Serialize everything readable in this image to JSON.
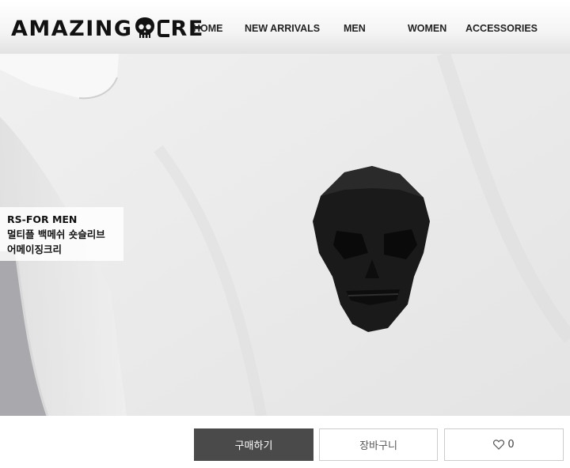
{
  "brand": {
    "logo_left": "AMAZING",
    "logo_right": "RE"
  },
  "nav": {
    "items": [
      {
        "label": "HOME"
      },
      {
        "label": "NEW ARRIVALS"
      },
      {
        "label": "MEN"
      },
      {
        "label": "WOMEN"
      },
      {
        "label": "ACCESSORIES"
      }
    ]
  },
  "product": {
    "caption_line1": "RS-FOR MEN",
    "caption_line2": "멀티플 백메쉬 숏슬리브",
    "caption_line3": "어메이징크리"
  },
  "actions": {
    "buy_label": "구매하기",
    "cart_label": "장바구니",
    "like_count": "0",
    "buy_color": "#4a4a4a"
  },
  "icons": {
    "logo_mark": "skull-icon",
    "like": "heart-icon"
  }
}
